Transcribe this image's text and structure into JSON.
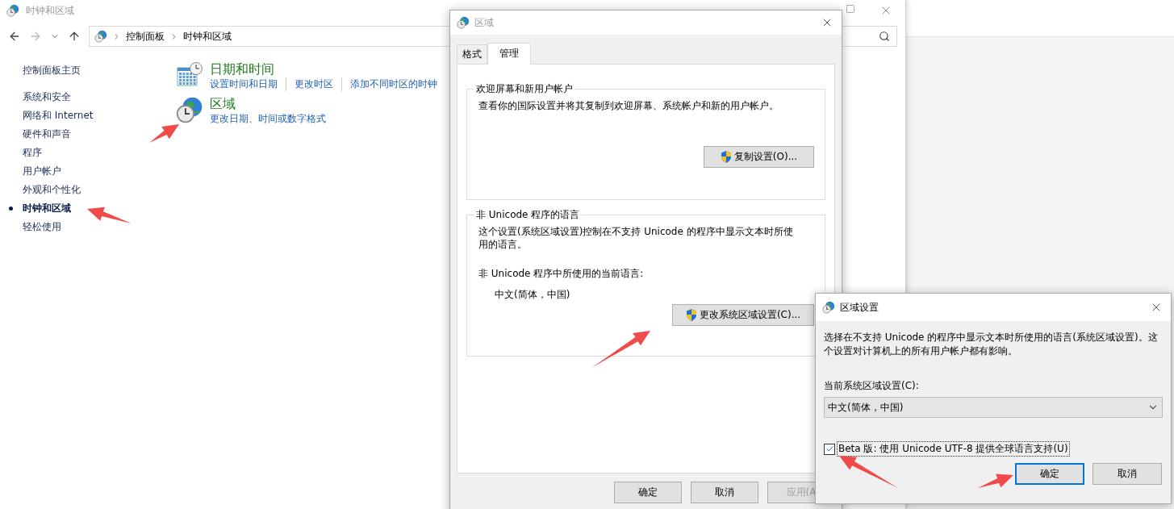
{
  "main_window": {
    "title": "时钟和区域",
    "breadcrumb": [
      "控制面板",
      "时钟和区域"
    ],
    "sidebar": {
      "home": "控制面板主页",
      "items": [
        {
          "label": "系统和安全",
          "selected": false
        },
        {
          "label": "网络和 Internet",
          "selected": false
        },
        {
          "label": "硬件和声音",
          "selected": false
        },
        {
          "label": "程序",
          "selected": false
        },
        {
          "label": "用户帐户",
          "selected": false
        },
        {
          "label": "外观和个性化",
          "selected": false
        },
        {
          "label": "时钟和区域",
          "selected": true
        },
        {
          "label": "轻松使用",
          "selected": false
        }
      ]
    },
    "categories": [
      {
        "kind": "calendar",
        "title": "日期和时间",
        "links": [
          "设置时间和日期",
          "更改时区",
          "添加不同时区的时钟"
        ]
      },
      {
        "kind": "globe",
        "title": "区域",
        "links": [
          "更改日期、时间或数字格式"
        ]
      }
    ]
  },
  "region_dialog": {
    "title": "区域",
    "tabs": [
      {
        "label": "格式",
        "selected": false
      },
      {
        "label": "管理",
        "selected": true
      }
    ],
    "groups": [
      {
        "title": "欢迎屏幕和新用户帐户",
        "description": "查看你的国际设置并将其复制到欢迎屏幕、系统帐户和新的用户帐户。",
        "button": "复制设置(O)..."
      },
      {
        "title": "非 Unicode 程序的语言",
        "description": "这个设置(系统区域设置)控制在不支持 Unicode 的程序中显示文本时所使用的语言。",
        "current_label": "非 Unicode 程序中所使用的当前语言:",
        "current_value": "中文(简体，中国)",
        "button": "更改系统区域设置(C)..."
      }
    ],
    "buttons": [
      {
        "label": "确定",
        "disabled": false
      },
      {
        "label": "取消",
        "disabled": false
      },
      {
        "label": "应用(A",
        "disabled": true
      }
    ]
  },
  "locale_dialog": {
    "title": "区域设置",
    "description": "选择在不支持 Unicode 的程序中显示文本时所使用的语言(系统区域设置)。这个设置对计算机上的所有用户帐户都有影响。",
    "select_label": "当前系统区域设置(C):",
    "select_value": "中文(简体，中国)",
    "checkbox": {
      "label": "Beta 版: 使用 Unicode UTF-8 提供全球语言支持(U)",
      "checked": true
    },
    "buttons": [
      {
        "label": "确定",
        "default": true
      },
      {
        "label": "取消",
        "default": false
      }
    ]
  }
}
